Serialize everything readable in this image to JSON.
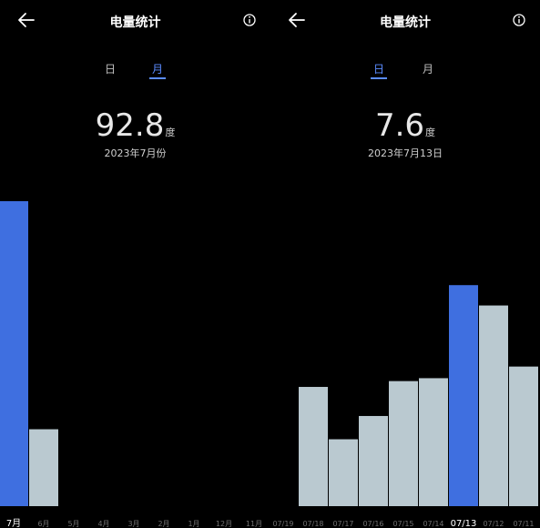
{
  "left": {
    "header": {
      "title": "电量统计",
      "back_icon": "arrow-left-icon",
      "info_icon": "info-icon"
    },
    "tabs": [
      {
        "label": "日",
        "active": false
      },
      {
        "label": "月",
        "active": true
      }
    ],
    "summary": {
      "value": "92.8",
      "unit": "度",
      "period": "2023年7月份"
    }
  },
  "right": {
    "header": {
      "title": "电量统计",
      "back_icon": "arrow-left-icon",
      "info_icon": "info-icon"
    },
    "tabs": [
      {
        "label": "日",
        "active": true
      },
      {
        "label": "月",
        "active": false
      }
    ],
    "summary": {
      "value": "7.6",
      "unit": "度",
      "period": "2023年7月13日"
    }
  },
  "colors": {
    "selected_bar": "#3f6fe0",
    "bar": "#bac9d0",
    "background": "#000000",
    "accent": "#5b8cff"
  },
  "chart_data": [
    {
      "type": "bar",
      "categories": [
        "7月",
        "6月",
        "5月",
        "4月",
        "3月",
        "2月",
        "1月",
        "12月",
        "11月"
      ],
      "values": [
        92.8,
        23.4,
        0,
        0,
        0,
        0,
        0,
        0,
        0
      ],
      "selected_index": 0,
      "ylim": [
        0,
        100
      ],
      "grid": false
    },
    {
      "type": "bar",
      "categories": [
        "07/19",
        "07/18",
        "07/17",
        "07/16",
        "07/15",
        "07/14",
        "07/13",
        "07/12",
        "07/11"
      ],
      "values": [
        0,
        4.1,
        2.3,
        3.1,
        4.3,
        4.4,
        7.6,
        6.9,
        4.8
      ],
      "selected_index": 6,
      "ylim": [
        0,
        11.3
      ],
      "grid": false
    }
  ]
}
